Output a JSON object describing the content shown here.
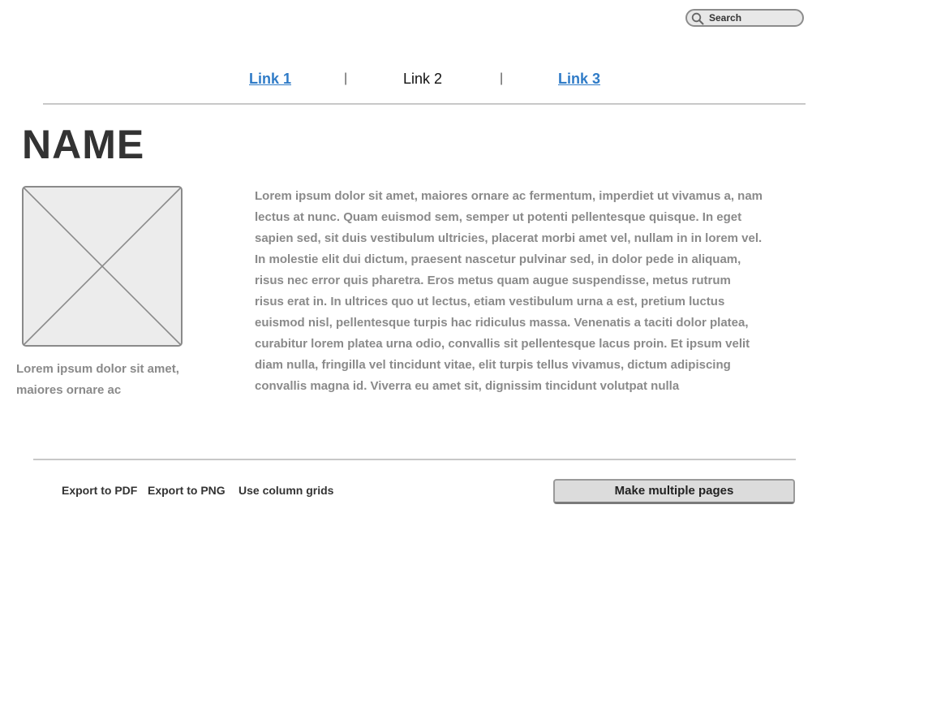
{
  "search": {
    "placeholder": "Search"
  },
  "nav": {
    "items": [
      {
        "label": "Link 1",
        "active": false
      },
      {
        "label": "Link 2",
        "active": true
      },
      {
        "label": "Link 3",
        "active": false
      }
    ],
    "separator": "|"
  },
  "page": {
    "title": "NAME",
    "image_caption": "Lorem ipsum dolor sit amet, maiores ornare ac",
    "body_text": "Lorem ipsum dolor sit amet, maiores ornare ac fermentum, imperdiet ut vivamus a, nam lectus at nunc. Quam euismod sem, semper ut potenti pellentesque quisque. In eget sapien sed, sit duis vestibulum ultricies, placerat morbi amet vel, nullam in in lorem vel. In molestie elit dui dictum, praesent nascetur pulvinar sed, in dolor pede in aliquam, risus nec error quis pharetra. Eros metus quam augue suspendisse, metus rutrum risus erat in. In ultrices quo ut lectus, etiam vestibulum urna a est, pretium luctus euismod nisl, pellentesque turpis hac ridiculus massa. Venenatis a taciti dolor platea, curabitur lorem platea urna odio, convallis sit pellentesque lacus proin. Et ipsum velit diam nulla, fringilla vel tincidunt vitae, elit turpis tellus vivamus, dictum adipiscing convallis magna id. Viverra eu amet sit, dignissim tincidunt volutpat nulla"
  },
  "footer": {
    "export_pdf": "Export to PDF",
    "export_png": "Export to PNG",
    "column_grids": "Use column grids",
    "make_pages_button": "Make multiple pages"
  },
  "colors": {
    "link": "#2f7bc7",
    "text_muted": "#8a8a8a",
    "text_dark": "#333333",
    "rule": "#c8c8c8"
  },
  "icons": {
    "search": "magnifier-icon",
    "image": "image-placeholder-icon"
  }
}
